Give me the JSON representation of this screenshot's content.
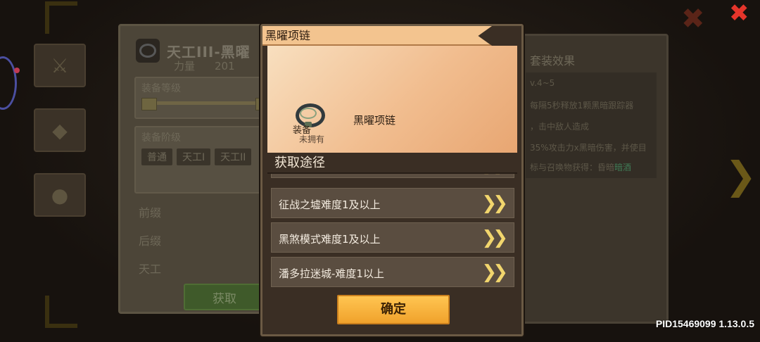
{
  "background": {
    "item_title": "天工ⅠⅠⅠ-黑曜",
    "stat_label": "力量",
    "stat_value": "201",
    "level_label": "装备等级",
    "tier_label": "装备阶级",
    "tier_chips": [
      "普通",
      "天工I",
      "天工II"
    ],
    "attr_labels": [
      "前缀",
      "后缀",
      "天工"
    ],
    "get_button": "获取",
    "effect_title": "套装效果",
    "effect_lines": [
      "v.4~5",
      "每隔5秒释放1颗黑暗跟踪器",
      "，击中敌人造成",
      "35%攻击力x黑暗伤害，并使目",
      "标与召唤物获得：昏暗"
    ],
    "effect_highlight": "暗酒"
  },
  "modal": {
    "header": "黑曜项链",
    "item": {
      "name": "黑曜项链",
      "type": "装备",
      "owned_status": "未拥有"
    },
    "sources_title": "获取途径",
    "sources": [
      {
        "label": "征战之墟难度1及以上"
      },
      {
        "label": "黑煞模式难度1及以上"
      },
      {
        "label": "潘多拉迷城-难度1以上"
      }
    ],
    "arrow_glyph": "❯❯",
    "confirm_label": "确定"
  },
  "footer": {
    "pid": "PID15469099 1.13.0.5"
  },
  "close_glyph": "✖",
  "colors": {
    "accent": "#f0a22c",
    "close": "#e5352b",
    "card": "#f1bd8f"
  }
}
